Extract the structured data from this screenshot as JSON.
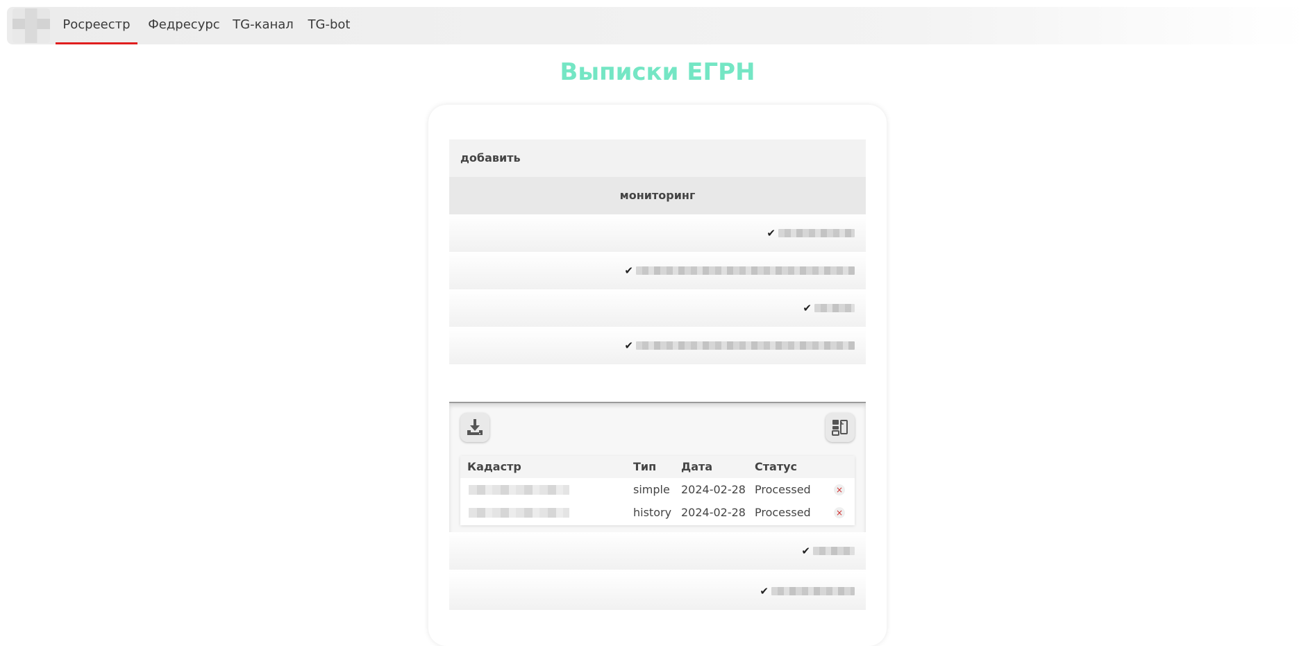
{
  "nav": {
    "items": [
      {
        "label": "Росреестр",
        "active": true
      },
      {
        "label": "Федресурс",
        "active": false
      },
      {
        "label": "TG-канал",
        "active": false
      },
      {
        "label": "TG-bot",
        "active": false
      }
    ],
    "active_color": "#e01e1e"
  },
  "page": {
    "title": "Выписки ЕГРН",
    "title_color": "#74e6c4"
  },
  "panel": {
    "add_label": "добавить",
    "monitoring_label": "мониторинг",
    "check_mark": "✔",
    "download_icon": "download-icon",
    "export_icon": "export-icon"
  },
  "table": {
    "headers": [
      "Кадастр",
      "Тип",
      "Дата",
      "Статус"
    ],
    "rows": [
      {
        "type": "simple",
        "date": "2024-02-28",
        "status": "Processed",
        "delete": "×"
      },
      {
        "type": "history",
        "date": "2024-02-28",
        "status": "Processed",
        "delete": "×"
      }
    ]
  }
}
